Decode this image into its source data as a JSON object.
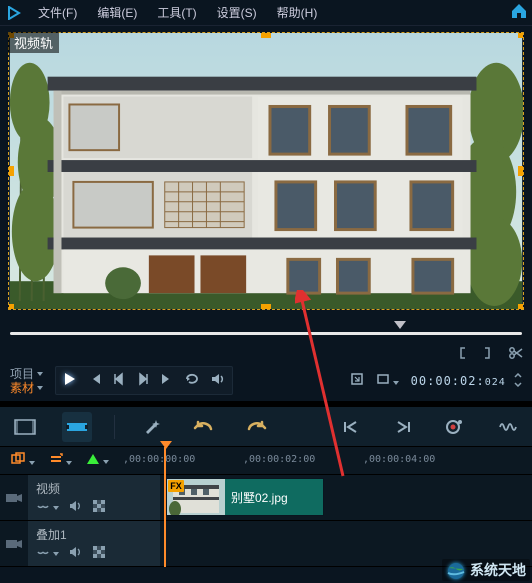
{
  "menu": {
    "file": "文件(F)",
    "edit": "编辑(E)",
    "tools": "工具(T)",
    "settings": "设置(S)",
    "help": "帮助(H)"
  },
  "preview": {
    "track_label": "视频轨"
  },
  "transport": {
    "project_label": "项目",
    "material_label": "素材",
    "timecode": "00:00:02:",
    "timecode_frames": "024"
  },
  "ruler": {
    "t0": ",00:00:00:00",
    "t1": ",00:00:02:00",
    "t2": ",00:00:04:00"
  },
  "tracks": {
    "video": {
      "name": "视频"
    },
    "overlay": {
      "name": "叠加1"
    }
  },
  "clip": {
    "fx_badge": "FX",
    "label": "别墅02.jpg"
  },
  "watermark": {
    "text": "系统天地"
  }
}
